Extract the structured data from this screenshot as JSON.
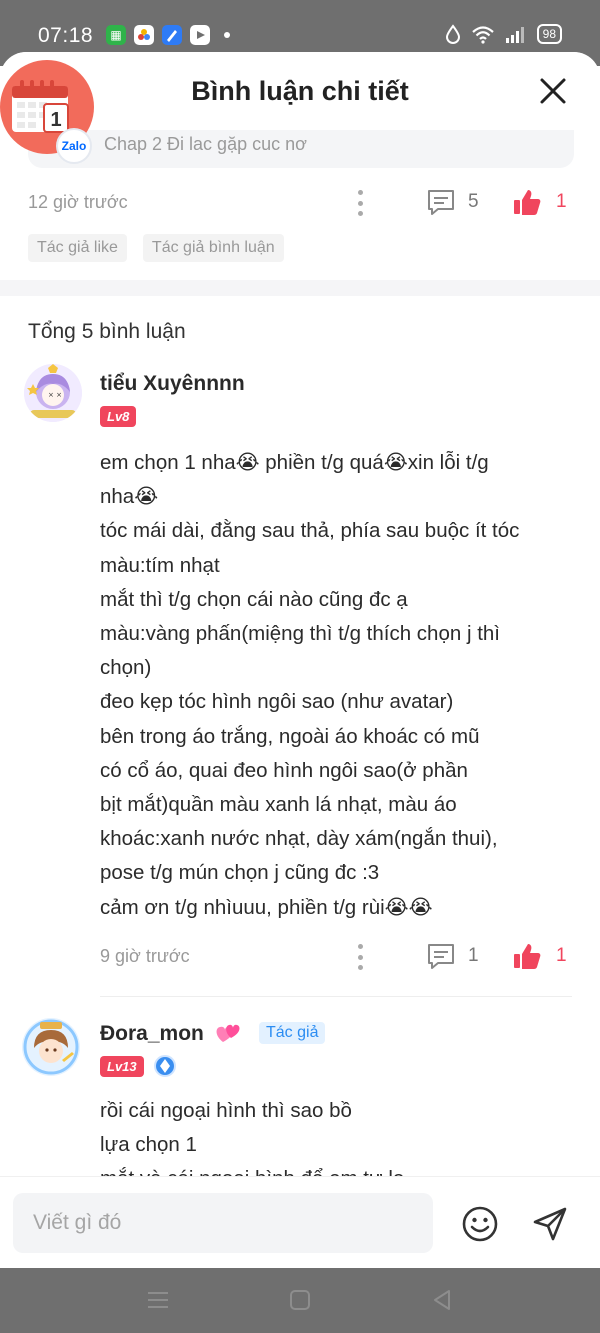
{
  "status_bar": {
    "time": "07:18",
    "battery": "98",
    "icons": [
      "wifi-icon",
      "signal-icon",
      "data-saver-icon"
    ]
  },
  "header": {
    "title": "Bình luận chi tiết",
    "zalo_label": "Zalo"
  },
  "chapter": {
    "text": "Chap 2 Đi lac gặp cuc nơ"
  },
  "top_comment_meta": {
    "time": "12 giờ trước",
    "replies": "5",
    "likes": "1",
    "tags": [
      "Tác giả like",
      "Tác giả bình luận"
    ]
  },
  "total_label": "Tổng 5 bình luận",
  "comments": [
    {
      "username": "tiểu Xuyênnnn",
      "level": "Lv8",
      "lines": [
        "em chọn 1 nha😭 phiền t/g quá😭xin lỗi t/g",
        "nha😭",
        "tóc mái dài, đằng sau thả, phía sau buộc ít tóc",
        "màu:tím nhạt",
        "mắt thì t/g chọn cái nào cũng đc ạ",
        "màu:vàng phấn(miệng thì t/g thích chọn j thì",
        "chọn)",
        "đeo kẹp tóc hình ngôi sao (như avatar)",
        "bên trong áo trắng, ngoài áo khoác có mũ",
        "có cổ áo, quai đeo hình ngôi sao(ở phần",
        "bịt mắt)quần màu xanh lá nhạt, màu áo",
        "khoác:xanh nước nhạt, dày xám(ngắn thui),",
        "pose t/g mún chọn j cũng đc :3",
        "cảm ơn t/g nhìuuu, phiền t/g rùi😭😭"
      ],
      "time": "9 giờ trước",
      "replies": "1",
      "likes": "1"
    },
    {
      "username": "Đora_mon",
      "level": "Lv13",
      "author_badge": "Tác giả",
      "lines": [
        "rồi cái ngoại hình thì sao bồ",
        "lựa chọn 1",
        "mắt và cái ngoại hình để em tự lo"
      ]
    }
  ],
  "input": {
    "placeholder": "Viết gì đó"
  },
  "colors": {
    "accent_red": "#f0455d",
    "author_blue": "#2c8df2",
    "status_bar_bg": "#6f6f6f"
  }
}
